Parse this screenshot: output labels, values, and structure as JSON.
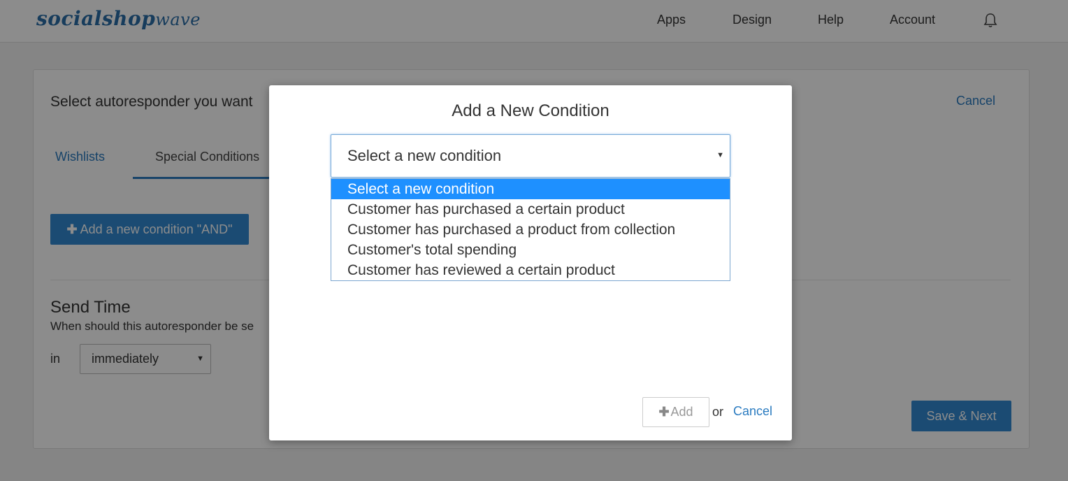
{
  "brand": {
    "logo_part1": "socialshop",
    "logo_part2": "wave"
  },
  "nav": {
    "items": [
      {
        "label": "Apps"
      },
      {
        "label": "Design"
      },
      {
        "label": "Help"
      },
      {
        "label": "Account"
      }
    ],
    "bell_icon": "bell-icon"
  },
  "panel": {
    "heading": "Select autoresponder you want",
    "cancel_label": "Cancel",
    "tabs": [
      {
        "label": "Wishlists",
        "active": false
      },
      {
        "label": "Special Conditions",
        "active": true
      }
    ],
    "add_condition_label": "Add a new condition \"AND\"",
    "send_time": {
      "title": "Send Time",
      "subtitle": "When should this autoresponder be se",
      "in_label": "in",
      "selected": "immediately"
    },
    "save_label": "Save & Next"
  },
  "modal": {
    "title": "Add a New Condition",
    "select": {
      "value": "Select a new condition",
      "options": [
        {
          "label": "Select a new condition",
          "selected": true
        },
        {
          "label": "Customer has purchased a certain product",
          "selected": false
        },
        {
          "label": "Customer has purchased a product from collection",
          "selected": false
        },
        {
          "label": "Customer's total spending",
          "selected": false
        },
        {
          "label": "Customer has reviewed a certain product",
          "selected": false
        }
      ]
    },
    "add_label": "Add",
    "or_text": "or",
    "cancel_label": "Cancel"
  },
  "colors": {
    "accent": "#3289d2",
    "link": "#2a7bc0",
    "highlight": "#1e90ff"
  }
}
